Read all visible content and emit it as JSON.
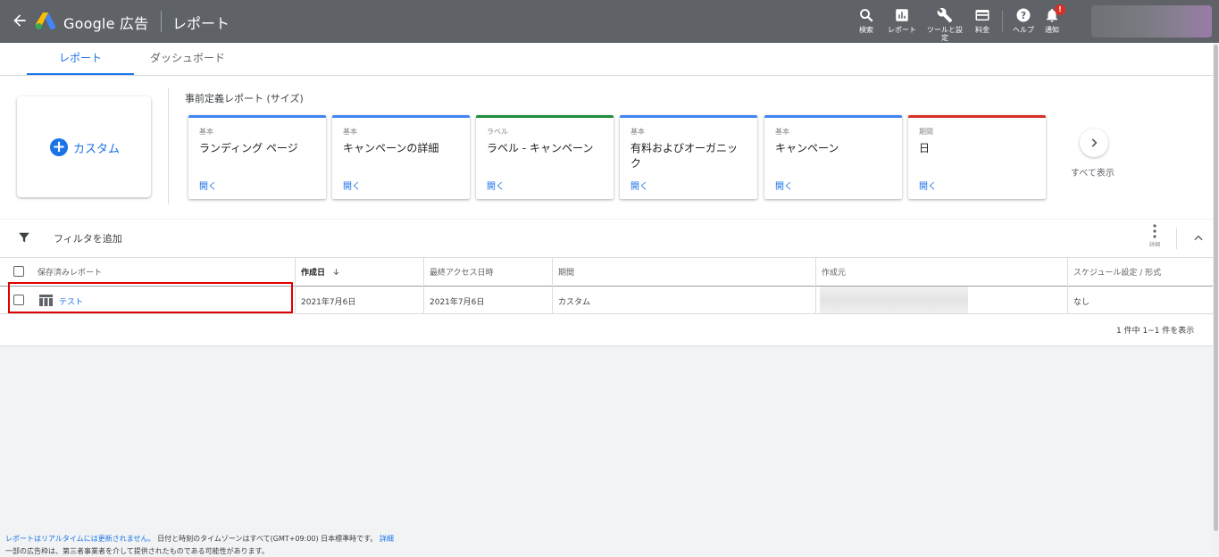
{
  "header": {
    "brand": "Google 広告",
    "page_title": "レポート",
    "tools": [
      {
        "label": "検索",
        "icon": "search-icon"
      },
      {
        "label": "レポート",
        "icon": "reports-icon"
      },
      {
        "label": "ツールと設定",
        "icon": "wrench-icon"
      },
      {
        "label": "料金",
        "icon": "billing-card-icon"
      },
      {
        "label": "ヘルプ",
        "icon": "help-icon"
      },
      {
        "label": "通知",
        "icon": "bell-icon"
      }
    ],
    "notification_badge": "!"
  },
  "tabs": [
    {
      "label": "レポート",
      "active": true
    },
    {
      "label": "ダッシュボード",
      "active": false
    }
  ],
  "predefined": {
    "custom_label": "カスタム",
    "section_title": "事前定義レポート (サイズ)",
    "cards": [
      {
        "category": "基本",
        "name": "ランディング ページ",
        "open": "開く",
        "color": "#4285f4"
      },
      {
        "category": "基本",
        "name": "キャンペーンの詳細",
        "open": "開く",
        "color": "#4285f4"
      },
      {
        "category": "ラベル",
        "name": "ラベル - キャンペーン",
        "open": "開く",
        "color": "#1e8e3e"
      },
      {
        "category": "基本",
        "name": "有料およびオーガニック",
        "open": "開く",
        "color": "#4285f4"
      },
      {
        "category": "基本",
        "name": "キャンペーン",
        "open": "開く",
        "color": "#4285f4"
      },
      {
        "category": "期間",
        "name": "日",
        "open": "開く",
        "color": "#d93025"
      }
    ],
    "show_all": "すべて表示"
  },
  "table": {
    "filter_label": "フィルタを追加",
    "more_label": "詳細",
    "columns": [
      "保存済みレポート",
      "作成日",
      "最終アクセス日時",
      "期間",
      "作成元",
      "スケジュール設定 / 形式"
    ],
    "rows": [
      {
        "name": "テスト",
        "created": "2021年7月6日",
        "last_access": "2021年7月6日",
        "period": "カスタム",
        "owner": "",
        "schedule": "なし"
      }
    ],
    "pagination": "1 件中 1~1 件を表示"
  },
  "footer": {
    "line1_link": "レポートはリアルタイムには更新されません。",
    "line1_text": " 日付と時刻のタイムゾーンはすべて(GMT+09:00) 日本標準時です。 ",
    "line1_detail": "詳細",
    "line2": "一部の広告枠は、第三者事業者を介して提供されたものである可能性があります。"
  },
  "colors": {
    "accent": "#1a73e8",
    "topbar": "#5f6368",
    "highlight": "#e00000"
  }
}
